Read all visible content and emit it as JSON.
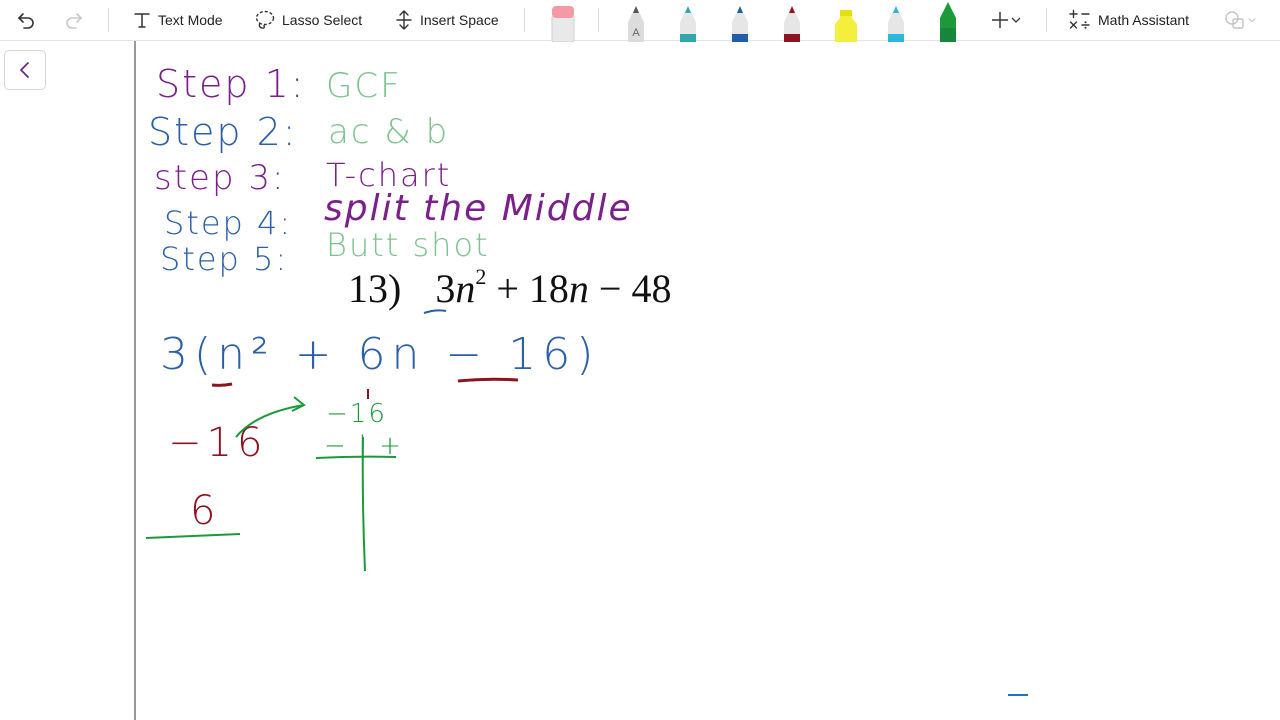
{
  "toolbar": {
    "text_mode": "Text Mode",
    "lasso_select": "Lasso Select",
    "insert_space": "Insert Space",
    "math_assistant": "Math Assistant"
  },
  "colors": {
    "purple": "#7b1f8c",
    "blue": "#2b5fa8",
    "green_light": "#7cc38f",
    "green": "#1c9a3a",
    "maroon": "#8b1420",
    "accent_blue": "#1a73c7"
  },
  "pens": [
    "pencil-gray",
    "pen-teal",
    "pen-blue",
    "pen-maroon",
    "highlighter-yellow",
    "pen-cyan",
    "pen-green"
  ],
  "notes": {
    "step1": {
      "label": "Step 1:",
      "value": "GCF"
    },
    "step2": {
      "label": "Step 2:",
      "value": "ac & b"
    },
    "step3": {
      "label": "step 3:",
      "value": "T-chart"
    },
    "step4": {
      "label": "Step 4:",
      "value": "split the Middle"
    },
    "step5": {
      "label": "Step 5:",
      "value": "Butt shot"
    }
  },
  "problem": {
    "number": "13)",
    "coef": "3",
    "var": "n",
    "exp": "2",
    "middle": "+ 18",
    "var2": "n",
    "tail": "− 48"
  },
  "work": {
    "gcf_line": "3(n² + 6n − 16)",
    "neg16": "−16",
    "six": "6",
    "tchart_top": "−16",
    "tchart_signs": "− | +"
  }
}
